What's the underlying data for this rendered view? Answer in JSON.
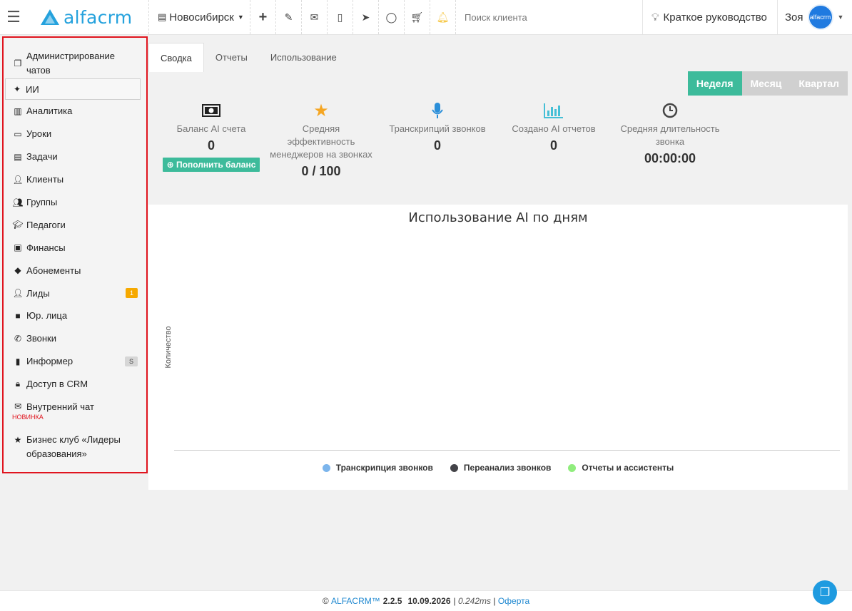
{
  "header": {
    "brand": "alfacrm",
    "branch": "Новосибирск",
    "search_placeholder": "Поиск клиента",
    "guide": "Краткое руководство",
    "user_name": "Зоя",
    "avatar_text": "alfacrm"
  },
  "sidebar": {
    "items": [
      {
        "label": "Администрирование чатов",
        "icon": "chats-icon"
      },
      {
        "label": "ИИ",
        "icon": "sparkles-icon"
      },
      {
        "label": "Аналитика",
        "icon": "map-icon"
      },
      {
        "label": "Уроки",
        "icon": "calendar-icon"
      },
      {
        "label": "Задачи",
        "icon": "clipboard-icon"
      },
      {
        "label": "Клиенты",
        "icon": "user-icon"
      },
      {
        "label": "Группы",
        "icon": "users-icon"
      },
      {
        "label": "Педагоги",
        "icon": "graduation-cap-icon"
      },
      {
        "label": "Финансы",
        "icon": "money-icon"
      },
      {
        "label": "Абонементы",
        "icon": "tag-icon"
      },
      {
        "label": "Лиды",
        "icon": "user-plus-icon",
        "badge": "1"
      },
      {
        "label": "Юр. лица",
        "icon": "briefcase-icon"
      },
      {
        "label": "Звонки",
        "icon": "phone-icon"
      },
      {
        "label": "Информер",
        "icon": "book-icon",
        "badge": "S"
      },
      {
        "label": "Доступ в CRM",
        "icon": "lock-icon"
      },
      {
        "label": "Внутренний чат",
        "icon": "envelope-icon",
        "note": "НОВИНКА"
      },
      {
        "label": "Бизнес клуб «Лидеры образования»",
        "icon": "star-icon"
      }
    ]
  },
  "tabs": [
    "Сводка",
    "Отчеты",
    "Использование"
  ],
  "period": [
    "Неделя",
    "Месяц",
    "Квартал"
  ],
  "stats": [
    {
      "label": "Баланс AI счета",
      "value": "0",
      "button": "Пополнить баланс",
      "icon": "money-icon"
    },
    {
      "label": "Средняя эффективность менеджеров на звонках",
      "value": "0 / 100",
      "icon": "star-icon"
    },
    {
      "label": "Транскрипций звонков",
      "value": "0",
      "icon": "microphone-icon"
    },
    {
      "label": "Создано AI отчетов",
      "value": "0",
      "icon": "bar-chart-icon"
    },
    {
      "label": "Средняя длительность звонка",
      "value": "00:00:00",
      "icon": "clock-icon"
    }
  ],
  "chart_data": {
    "type": "bar",
    "title": "Использование AI по дням",
    "ylabel": "Количество",
    "xlabel": "",
    "categories": [],
    "series": [
      {
        "name": "Транскрипция звонков",
        "values": [],
        "color": "#7cb5ec"
      },
      {
        "name": "Переанализ звонков",
        "values": [],
        "color": "#434348"
      },
      {
        "name": "Отчеты и ассистенты",
        "values": [],
        "color": "#90ed7d"
      }
    ]
  },
  "footer": {
    "copyright": "©",
    "brand": "ALFACRM™",
    "version": "2.2.5",
    "date": "10.09.2026",
    "sep": "|",
    "timing": "0.242ms",
    "offer": "Оферта"
  },
  "colors": {
    "accent": "#3dbb9b",
    "brand": "#25a2dd",
    "highlight_border": "#e0141e"
  }
}
